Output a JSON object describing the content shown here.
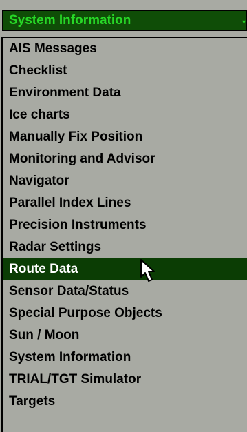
{
  "dropdown": {
    "selected_value": "System Information",
    "items": [
      {
        "label": "AIS Messages"
      },
      {
        "label": "Checklist"
      },
      {
        "label": "Environment Data"
      },
      {
        "label": "Ice charts"
      },
      {
        "label": "Manually Fix Position"
      },
      {
        "label": "Monitoring and Advisor"
      },
      {
        "label": "Navigator"
      },
      {
        "label": "Parallel Index Lines"
      },
      {
        "label": "Precision Instruments"
      },
      {
        "label": "Radar Settings"
      },
      {
        "label": "Route Data",
        "highlighted": true
      },
      {
        "label": "Sensor Data/Status"
      },
      {
        "label": "Special Purpose Objects"
      },
      {
        "label": "Sun / Moon"
      },
      {
        "label": "System Information"
      },
      {
        "label": "TRIAL/TGT Simulator"
      },
      {
        "label": "Targets"
      }
    ]
  },
  "colors": {
    "panel_bg": "#a8aaa3",
    "combo_bg": "#0f4d07",
    "combo_text": "#27d827",
    "highlight_bg": "#0b3d04",
    "highlight_text": "#ffffff",
    "item_text": "#000000"
  },
  "icons": {
    "combo_arrow": "chevron-down-icon",
    "pointer": "mouse-pointer-icon"
  }
}
